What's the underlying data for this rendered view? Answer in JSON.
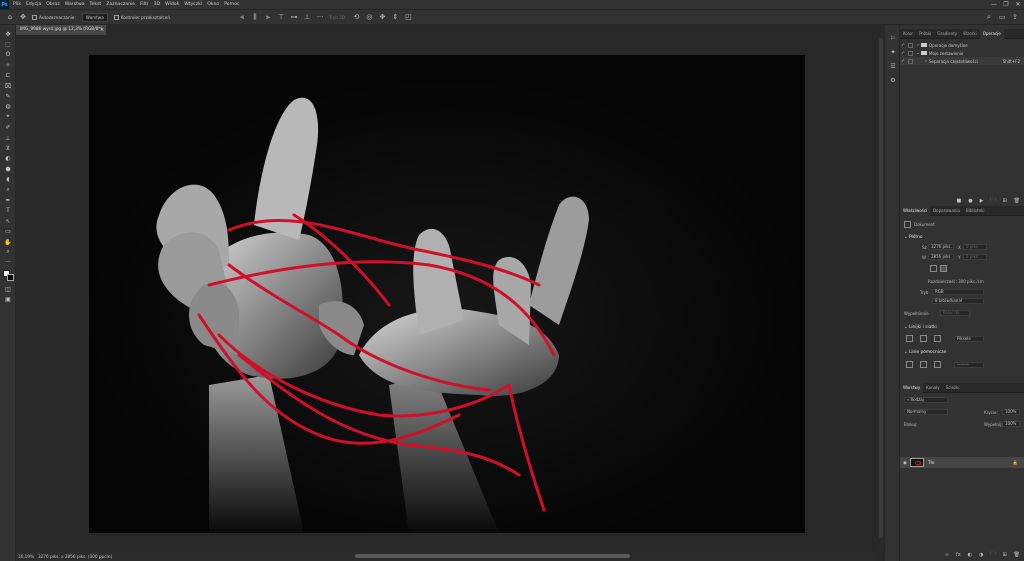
{
  "app": {
    "logo": "Ps"
  },
  "menu": [
    "Plik",
    "Edycja",
    "Obraz",
    "Warstwa",
    "Tekst",
    "Zaznaczanie",
    "Filtr",
    "3D",
    "Widok",
    "Wtyczki",
    "Okno",
    "Pomoc"
  ],
  "window_controls": {
    "min": "—",
    "max": "❐",
    "close": "✕"
  },
  "options_bar": {
    "auto_select_label": "Autozaznaczanie:",
    "target_value": "Warstwa",
    "transform_label": "Kontroler przekształceń",
    "mode_label": "Tryb 3D:"
  },
  "document": {
    "tab_title": "IMG_9986 wyrd.jpg @ 12,3% (RGB/8*)",
    "close": "×"
  },
  "status": {
    "zoom": "16,19%",
    "dimensions": "3276 piks. x 2856 piks. (300 ppcm)"
  },
  "tools": [
    "✥",
    "⬚",
    "ʘ",
    "✧",
    "⊏",
    "⌧",
    "✎",
    "◍",
    "⌖",
    "✐",
    "⊥",
    "⊻",
    "◐",
    "⬢",
    "◖",
    "⌕",
    "✒",
    "T",
    "↖",
    "▭",
    "✋",
    "⌕",
    "···"
  ],
  "strip_icons": [
    "⚐",
    "✦",
    "☰",
    "⚙"
  ],
  "actions_panel": {
    "tabs": [
      "Kolor",
      "Próbki",
      "Gradienty",
      "Wzorki",
      "Operacje"
    ],
    "active_tab": "Operacje",
    "rows": [
      {
        "label": "Operacje domyślne",
        "type": "folder",
        "selected": false,
        "extra": ""
      },
      {
        "label": "Moje zestawienie",
        "type": "folder",
        "selected": false,
        "extra": ""
      },
      {
        "label": "Separacja częstotliwości",
        "type": "action",
        "selected": true,
        "extra": "Shift+F2"
      }
    ],
    "footer_icons": [
      "■",
      "●",
      "▶",
      "🗀",
      "⊞",
      "🗑"
    ]
  },
  "properties_panel": {
    "tabs": [
      "Właściwości",
      "Dopasowania",
      "Biblioteki"
    ],
    "active_tab": "Właściwości",
    "kind": "Dokument",
    "canvas_section": "Płótno",
    "w_label": "Sz",
    "w_value": "3276 piks.",
    "x_label": "X",
    "x_value": "0 piks.",
    "h_label": "W",
    "h_value": "2856 piks.",
    "y_label": "Y",
    "y_value": "0 piks.",
    "resolution": "Rozdzielczość: 300 piks./cm",
    "mode_label": "Tryb",
    "mode_value": "RGB",
    "depth_value": "8 bitów/kanał",
    "fill_label": "Wypełnienie",
    "fill_value": "Kolor tła",
    "rulers_section": "Linijki i siatki",
    "rulers_unit": "Piksele",
    "guides_section": "Linie pomocnicze"
  },
  "layers_panel": {
    "tabs": [
      "Warstwy",
      "Kanały",
      "Ścieżki"
    ],
    "active_tab": "Warstwy",
    "filter_label": "Rodzaj",
    "blend_mode": "Normalny",
    "opacity_label": "Krycie:",
    "opacity_value": "100%",
    "lock_label": "Blokuj:",
    "fill_label": "Wypełnij:",
    "fill_value": "100%",
    "layer": {
      "name": "Tło"
    },
    "footer_icons": [
      "∞",
      "fx",
      "◐",
      "◑",
      "🗀",
      "⊞",
      "🗑"
    ]
  },
  "colors": {
    "accent_red": "#d0102a",
    "ui_dark": "#282828",
    "ui_panel": "#323232"
  }
}
